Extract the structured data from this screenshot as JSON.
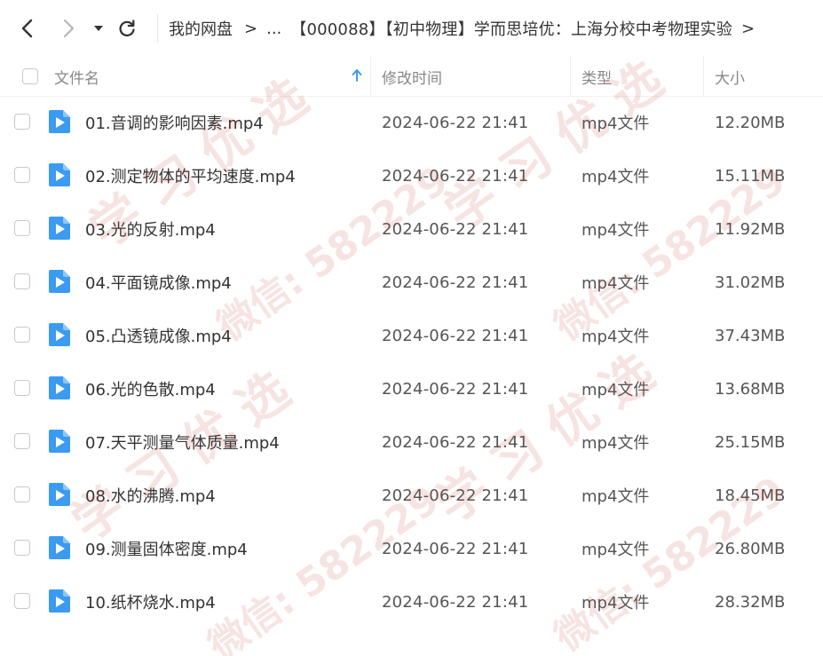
{
  "nav": {
    "back_icon": "chevron-left-icon",
    "forward_icon": "chevron-right-icon",
    "dropdown_icon": "caret-down-icon",
    "refresh_icon": "refresh-icon"
  },
  "breadcrumb": {
    "root": "我的网盘",
    "separator": ">",
    "ellipsis": "...",
    "current": "【000088】【初中物理】学而思培优：上海分校中考物理实验",
    "tail_separator": ">"
  },
  "table": {
    "headers": {
      "name": "文件名",
      "modified": "修改时间",
      "type": "类型",
      "size": "大小"
    },
    "sort_indicator": "arrow-up-icon",
    "rows": [
      {
        "name": "01.音调的影响因素.mp4",
        "modified": "2024-06-22 21:41",
        "type": "mp4文件",
        "size": "12.20MB"
      },
      {
        "name": "02.测定物体的平均速度.mp4",
        "modified": "2024-06-22 21:41",
        "type": "mp4文件",
        "size": "15.11MB"
      },
      {
        "name": "03.光的反射.mp4",
        "modified": "2024-06-22 21:41",
        "type": "mp4文件",
        "size": "11.92MB"
      },
      {
        "name": "04.平面镜成像.mp4",
        "modified": "2024-06-22 21:41",
        "type": "mp4文件",
        "size": "31.02MB"
      },
      {
        "name": "05.凸透镜成像.mp4",
        "modified": "2024-06-22 21:41",
        "type": "mp4文件",
        "size": "37.43MB"
      },
      {
        "name": "06.光的色散.mp4",
        "modified": "2024-06-22 21:41",
        "type": "mp4文件",
        "size": "13.68MB"
      },
      {
        "name": "07.天平测量气体质量.mp4",
        "modified": "2024-06-22 21:41",
        "type": "mp4文件",
        "size": "25.15MB"
      },
      {
        "name": "08.水的沸腾.mp4",
        "modified": "2024-06-22 21:41",
        "type": "mp4文件",
        "size": "18.45MB"
      },
      {
        "name": "09.测量固体密度.mp4",
        "modified": "2024-06-22 21:41",
        "type": "mp4文件",
        "size": "26.80MB"
      },
      {
        "name": "10.纸杯烧水.mp4",
        "modified": "2024-06-22 21:41",
        "type": "mp4文件",
        "size": "28.32MB"
      }
    ]
  },
  "watermark": {
    "text_a": "学 习 优 选",
    "text_b": "微信: 582229"
  },
  "colors": {
    "file_icon": "#3a9bf0",
    "sort_arrow": "#3a9bf0",
    "watermark": "#c0392b"
  }
}
